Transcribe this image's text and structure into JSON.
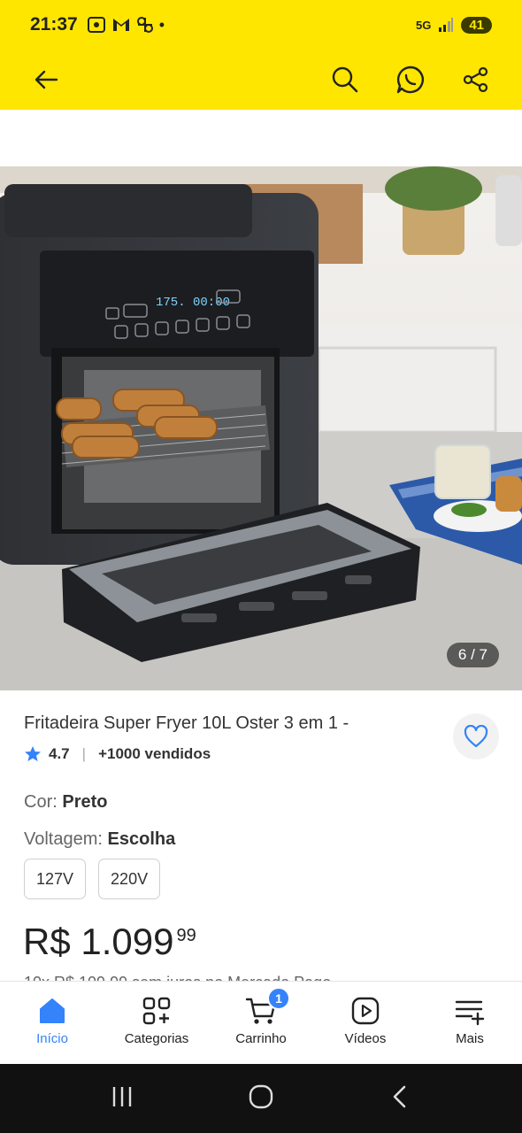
{
  "status": {
    "time": "21:37",
    "battery": "41",
    "network": "5G"
  },
  "product": {
    "image_counter": "6 / 7",
    "title": "Fritadeira Super Fryer 10L Oster 3 em 1 -",
    "rating": "4.7",
    "sold": "+1000 vendidos",
    "color_label": "Cor:",
    "color_value": "Preto",
    "voltage_label": "Voltagem:",
    "voltage_value": "Escolha",
    "voltage_options": [
      "127V",
      "220V"
    ],
    "price_main": "R$ 1.099",
    "price_cents": "99",
    "installments_partial": "10x R$ 109,99 sem juros no Mercado Pago"
  },
  "bottom_nav": {
    "items": [
      {
        "label": "Início",
        "icon": "home-icon"
      },
      {
        "label": "Categorias",
        "icon": "categories-icon"
      },
      {
        "label": "Carrinho",
        "icon": "cart-icon"
      },
      {
        "label": "Vídeos",
        "icon": "video-icon"
      },
      {
        "label": "Mais",
        "icon": "more-icon"
      }
    ],
    "cart_count": "1"
  },
  "colors": {
    "brand_yellow": "#ffe600",
    "accent_blue": "#3483fa"
  }
}
